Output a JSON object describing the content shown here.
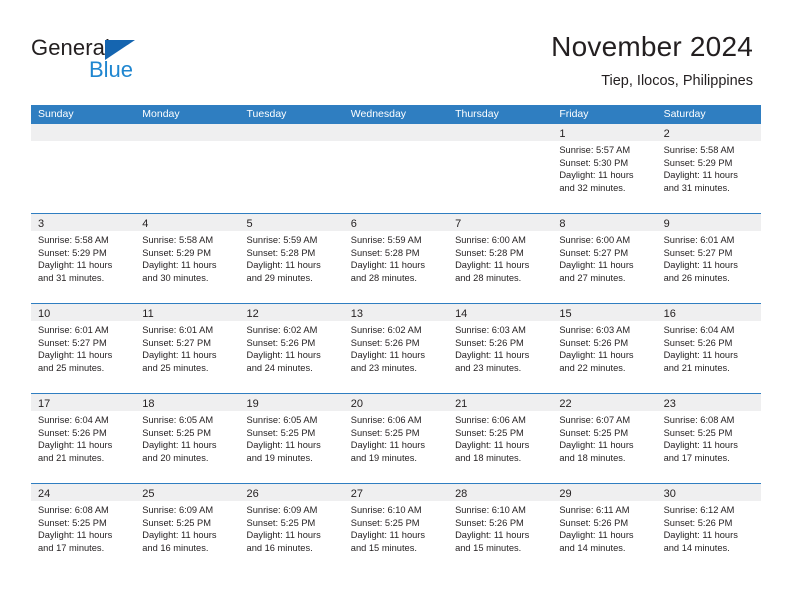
{
  "brand": {
    "name_part1": "General",
    "name_part2": "Blue",
    "logo_icon": "triangle-logo-icon"
  },
  "header": {
    "title": "November 2024",
    "subtitle": "Tiep, Ilocos, Philippines"
  },
  "calendar": {
    "weekday_headers": [
      "Sunday",
      "Monday",
      "Tuesday",
      "Wednesday",
      "Thursday",
      "Friday",
      "Saturday"
    ],
    "accent_color": "#2f7ec1",
    "daynum_band_color": "#efeff0",
    "weeks": [
      [
        {
          "day": "",
          "lines": []
        },
        {
          "day": "",
          "lines": []
        },
        {
          "day": "",
          "lines": []
        },
        {
          "day": "",
          "lines": []
        },
        {
          "day": "",
          "lines": []
        },
        {
          "day": "1",
          "lines": [
            "Sunrise: 5:57 AM",
            "Sunset: 5:30 PM",
            "Daylight: 11 hours",
            "and 32 minutes."
          ]
        },
        {
          "day": "2",
          "lines": [
            "Sunrise: 5:58 AM",
            "Sunset: 5:29 PM",
            "Daylight: 11 hours",
            "and 31 minutes."
          ]
        }
      ],
      [
        {
          "day": "3",
          "lines": [
            "Sunrise: 5:58 AM",
            "Sunset: 5:29 PM",
            "Daylight: 11 hours",
            "and 31 minutes."
          ]
        },
        {
          "day": "4",
          "lines": [
            "Sunrise: 5:58 AM",
            "Sunset: 5:29 PM",
            "Daylight: 11 hours",
            "and 30 minutes."
          ]
        },
        {
          "day": "5",
          "lines": [
            "Sunrise: 5:59 AM",
            "Sunset: 5:28 PM",
            "Daylight: 11 hours",
            "and 29 minutes."
          ]
        },
        {
          "day": "6",
          "lines": [
            "Sunrise: 5:59 AM",
            "Sunset: 5:28 PM",
            "Daylight: 11 hours",
            "and 28 minutes."
          ]
        },
        {
          "day": "7",
          "lines": [
            "Sunrise: 6:00 AM",
            "Sunset: 5:28 PM",
            "Daylight: 11 hours",
            "and 28 minutes."
          ]
        },
        {
          "day": "8",
          "lines": [
            "Sunrise: 6:00 AM",
            "Sunset: 5:27 PM",
            "Daylight: 11 hours",
            "and 27 minutes."
          ]
        },
        {
          "day": "9",
          "lines": [
            "Sunrise: 6:01 AM",
            "Sunset: 5:27 PM",
            "Daylight: 11 hours",
            "and 26 minutes."
          ]
        }
      ],
      [
        {
          "day": "10",
          "lines": [
            "Sunrise: 6:01 AM",
            "Sunset: 5:27 PM",
            "Daylight: 11 hours",
            "and 25 minutes."
          ]
        },
        {
          "day": "11",
          "lines": [
            "Sunrise: 6:01 AM",
            "Sunset: 5:27 PM",
            "Daylight: 11 hours",
            "and 25 minutes."
          ]
        },
        {
          "day": "12",
          "lines": [
            "Sunrise: 6:02 AM",
            "Sunset: 5:26 PM",
            "Daylight: 11 hours",
            "and 24 minutes."
          ]
        },
        {
          "day": "13",
          "lines": [
            "Sunrise: 6:02 AM",
            "Sunset: 5:26 PM",
            "Daylight: 11 hours",
            "and 23 minutes."
          ]
        },
        {
          "day": "14",
          "lines": [
            "Sunrise: 6:03 AM",
            "Sunset: 5:26 PM",
            "Daylight: 11 hours",
            "and 23 minutes."
          ]
        },
        {
          "day": "15",
          "lines": [
            "Sunrise: 6:03 AM",
            "Sunset: 5:26 PM",
            "Daylight: 11 hours",
            "and 22 minutes."
          ]
        },
        {
          "day": "16",
          "lines": [
            "Sunrise: 6:04 AM",
            "Sunset: 5:26 PM",
            "Daylight: 11 hours",
            "and 21 minutes."
          ]
        }
      ],
      [
        {
          "day": "17",
          "lines": [
            "Sunrise: 6:04 AM",
            "Sunset: 5:26 PM",
            "Daylight: 11 hours",
            "and 21 minutes."
          ]
        },
        {
          "day": "18",
          "lines": [
            "Sunrise: 6:05 AM",
            "Sunset: 5:25 PM",
            "Daylight: 11 hours",
            "and 20 minutes."
          ]
        },
        {
          "day": "19",
          "lines": [
            "Sunrise: 6:05 AM",
            "Sunset: 5:25 PM",
            "Daylight: 11 hours",
            "and 19 minutes."
          ]
        },
        {
          "day": "20",
          "lines": [
            "Sunrise: 6:06 AM",
            "Sunset: 5:25 PM",
            "Daylight: 11 hours",
            "and 19 minutes."
          ]
        },
        {
          "day": "21",
          "lines": [
            "Sunrise: 6:06 AM",
            "Sunset: 5:25 PM",
            "Daylight: 11 hours",
            "and 18 minutes."
          ]
        },
        {
          "day": "22",
          "lines": [
            "Sunrise: 6:07 AM",
            "Sunset: 5:25 PM",
            "Daylight: 11 hours",
            "and 18 minutes."
          ]
        },
        {
          "day": "23",
          "lines": [
            "Sunrise: 6:08 AM",
            "Sunset: 5:25 PM",
            "Daylight: 11 hours",
            "and 17 minutes."
          ]
        }
      ],
      [
        {
          "day": "24",
          "lines": [
            "Sunrise: 6:08 AM",
            "Sunset: 5:25 PM",
            "Daylight: 11 hours",
            "and 17 minutes."
          ]
        },
        {
          "day": "25",
          "lines": [
            "Sunrise: 6:09 AM",
            "Sunset: 5:25 PM",
            "Daylight: 11 hours",
            "and 16 minutes."
          ]
        },
        {
          "day": "26",
          "lines": [
            "Sunrise: 6:09 AM",
            "Sunset: 5:25 PM",
            "Daylight: 11 hours",
            "and 16 minutes."
          ]
        },
        {
          "day": "27",
          "lines": [
            "Sunrise: 6:10 AM",
            "Sunset: 5:25 PM",
            "Daylight: 11 hours",
            "and 15 minutes."
          ]
        },
        {
          "day": "28",
          "lines": [
            "Sunrise: 6:10 AM",
            "Sunset: 5:26 PM",
            "Daylight: 11 hours",
            "and 15 minutes."
          ]
        },
        {
          "day": "29",
          "lines": [
            "Sunrise: 6:11 AM",
            "Sunset: 5:26 PM",
            "Daylight: 11 hours",
            "and 14 minutes."
          ]
        },
        {
          "day": "30",
          "lines": [
            "Sunrise: 6:12 AM",
            "Sunset: 5:26 PM",
            "Daylight: 11 hours",
            "and 14 minutes."
          ]
        }
      ]
    ]
  }
}
